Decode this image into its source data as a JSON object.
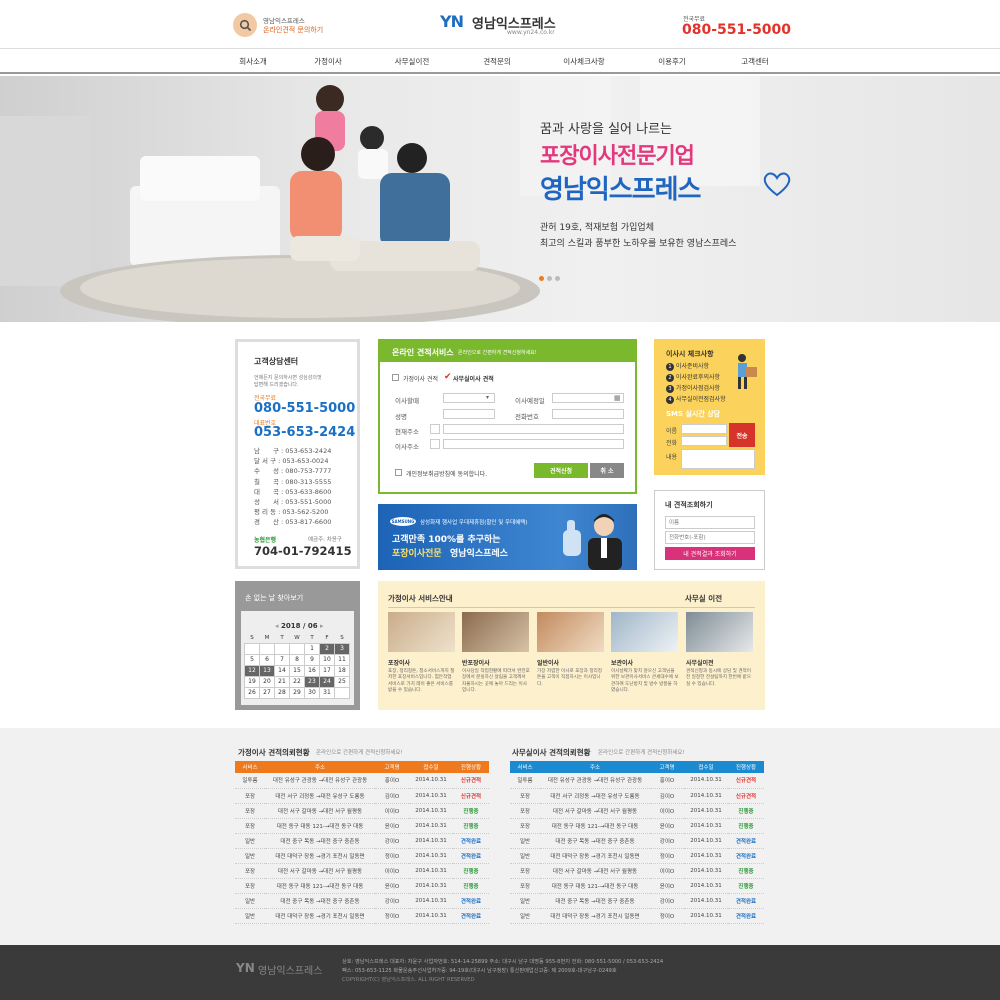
{
  "header": {
    "consult_line1": "영남익스프레스",
    "consult_line2": "온라인견적 문의하기",
    "logo_yn": "YN",
    "logo_name": "영남익스프레스",
    "logo_url": "www.yn24.co.kr",
    "phone_label": "전국무료",
    "phone": "080-551-5000"
  },
  "nav": [
    "회사소개",
    "가정이사",
    "사무실이전",
    "견적문의",
    "이사체크사항",
    "이용후기",
    "고객센터"
  ],
  "hero": {
    "line1": "꿈과 사랑을 실어 나르는",
    "line2": "포장이사전문기업",
    "line3": "영남익스프레스",
    "line4": "관허 19호, 적재보험 가입업체",
    "line5": "최고의 스킬과 풍부한 노하우를 보유한 영남스프레스"
  },
  "customer_center": {
    "title": "고객상담센터",
    "desc1": "언제든지 문의하시면 성심성의껏",
    "desc2": "답변해 드리겠습니다.",
    "label_free": "전국무료",
    "phone_free": "080-551-5000",
    "label_rep": "대표번호",
    "phone_rep": "053-653-2424",
    "branches": [
      {
        "name": "남　　구",
        "tel": "053-653-2424"
      },
      {
        "name": "달 서 구",
        "tel": "053-653-0024"
      },
      {
        "name": "수　　성",
        "tel": "080-753-7777"
      },
      {
        "name": "칠　　곡",
        "tel": "080-313-5555"
      },
      {
        "name": "대　　곡",
        "tel": "053-633-8600"
      },
      {
        "name": "성　　서",
        "tel": "053-551-5000"
      },
      {
        "name": "평 리 동",
        "tel": "053-562-5200"
      },
      {
        "name": "경　　산",
        "tel": "053-817-6600"
      }
    ],
    "bank": "농협은행",
    "holder": "예금주: 차윤구",
    "account": "704-01-792415"
  },
  "estimate": {
    "title": "온라인 견적서비스",
    "subtitle": "온라인으로 간편하게 견적신청하세요!",
    "radio1": "가정이사 견적",
    "radio2": "사무실이사 견적",
    "f_date": "이사할때",
    "f_moveday": "이사예정일",
    "f_name": "성명",
    "f_tel": "전화번호",
    "f_cur": "현재주소",
    "f_new": "이사주소",
    "agree": "개인정보취급방침에 동의합니다.",
    "submit": "견적신청",
    "cancel": "취 소"
  },
  "checklist": {
    "title": "이사시 체크사항",
    "items": [
      "이사준비사항",
      "이사완료후의사항",
      "가정이사점검사항",
      "사무실이전점검사항"
    ],
    "sms_title": "SMS 실시간 상담",
    "f_name": "이름",
    "f_tel": "전화",
    "f_content": "내용",
    "send": "전송"
  },
  "banner": {
    "brand": "SAMSUNG",
    "line1": "삼성화재 행사업 우대제휴점(할인 및 우대혜택)",
    "line2": "고객만족 100%를 추구하는",
    "line3": "포장이사전문",
    "line4": "영남익스프레스"
  },
  "lookup": {
    "title": "내 견적조회하기",
    "name_ph": "이름",
    "tel_ph": "전화번호(-포함)",
    "button": "내 견적결과 조회하기"
  },
  "calendar": {
    "title": "손 없는 날 찾아보기",
    "month": "2018 / 06",
    "days": [
      "S",
      "M",
      "T",
      "W",
      "T",
      "F",
      "S"
    ],
    "weeks": [
      [
        "",
        "",
        "",
        "",
        "1",
        "2",
        "3"
      ],
      [
        "",
        "",
        "",
        "",
        "",
        "",
        ""
      ],
      [
        "5",
        "6",
        "7",
        "8",
        "9",
        "10",
        "11"
      ],
      [
        "12",
        "13",
        "14",
        "15",
        "16",
        "17",
        "18"
      ],
      [
        "19",
        "20",
        "21",
        "22",
        "23",
        "24",
        "25"
      ],
      [
        "26",
        "27",
        "28",
        "29",
        "30",
        "31",
        ""
      ]
    ]
  },
  "services": {
    "title_home": "가정이사 서비스안내",
    "title_office": "사무실 이전",
    "items": [
      {
        "name": "포장이사",
        "desc": "포장, 정리정돈, 청소서비스까지 철저한 포장서비스입니다. 힘든작업 서비스로 가치 레이 좋은 서비스를 받을 수 있습니다."
      },
      {
        "name": "반포장이사",
        "desc": "이사당일 작업현황에 따라서 완전포장에서 분실하신 살림을 고객께서 자율하시는 곳에 놓아 드리는 이사입니다."
      },
      {
        "name": "일반이사",
        "desc": "가장 저렴한 이사로 포장과 정리정돈을 고객이 직접하시는 이사입니다."
      },
      {
        "name": "보관이사",
        "desc": "이사날짜가 맞지 않으신 고객님을 위한 보관이사서비스 큰세대수에 보관하여 도난방지 및 방수 방풍을 하였습니다."
      },
      {
        "name": "사무실이전",
        "desc": "견적신청과 동시에 상담 및 견적이전 일정한 전설팀까지 한번에 받으실 수 있습니다."
      }
    ]
  },
  "home_table": {
    "title": "가정이사 견적의뢰현황",
    "subtitle": "온라인으로 간편하게 견적신청하세요!",
    "headers": [
      "서비스",
      "주소",
      "고객명",
      "접수일",
      "진행상황"
    ],
    "rows": [
      [
        "일투룸",
        "대전 유성구 관광동 →대전 유성구 관광동",
        "홍이O",
        "2014.10.31",
        "신규견적"
      ],
      [
        "포장",
        "대전 서구 괴정동 →대전 유성구 도룡동",
        "김이O",
        "2014.10.31",
        "신규견적"
      ],
      [
        "포장",
        "대전 서구 갈마동 →대전 서구 월평동",
        "이이O",
        "2014.10.31",
        "진행중"
      ],
      [
        "포장",
        "대전 동구 대동 121-→대전 동구 대동",
        "윤이O",
        "2014.10.31",
        "진행중"
      ],
      [
        "일반",
        "대전 중구 목동 →대전 중구 중촌동",
        "강이O",
        "2014.10.31",
        "견적완료"
      ],
      [
        "일반",
        "대전 대덕구 장동 →경기 포천시 일동면",
        "정이O",
        "2014.10.31",
        "견적완료"
      ],
      [
        "포장",
        "대전 서구 갈마동 →대전 서구 월평동",
        "이이O",
        "2014.10.31",
        "진행중"
      ],
      [
        "포장",
        "대전 동구 대동 121-→대전 동구 대동",
        "윤이O",
        "2014.10.31",
        "진행중"
      ],
      [
        "일반",
        "대전 중구 목동 →대전 중구 중촌동",
        "강이O",
        "2014.10.31",
        "견적완료"
      ],
      [
        "일반",
        "대전 대덕구 장동 →경기 포천시 일동면",
        "정이O",
        "2014.10.31",
        "견적완료"
      ]
    ]
  },
  "office_table": {
    "title": "사무실이사 견적의뢰현황",
    "subtitle": "온라인으로 간편하게 견적신청하세요!",
    "headers": [
      "서비스",
      "주소",
      "고객명",
      "접수일",
      "진행상황"
    ],
    "rows": [
      [
        "일투룸",
        "대전 유성구 관광동 →대전 유성구 관광동",
        "홍이O",
        "2014.10.31",
        "신규견적"
      ],
      [
        "포장",
        "대전 서구 괴정동 →대전 유성구 도룡동",
        "김이O",
        "2014.10.31",
        "신규견적"
      ],
      [
        "포장",
        "대전 서구 갈마동 →대전 서구 월평동",
        "이이O",
        "2014.10.31",
        "진행중"
      ],
      [
        "포장",
        "대전 동구 대동 121-→대전 동구 대동",
        "윤이O",
        "2014.10.31",
        "진행중"
      ],
      [
        "일반",
        "대전 중구 목동 →대전 중구 중촌동",
        "강이O",
        "2014.10.31",
        "견적완료"
      ],
      [
        "일반",
        "대전 대덕구 장동 →경기 포천시 일동면",
        "정이O",
        "2014.10.31",
        "견적완료"
      ],
      [
        "포장",
        "대전 서구 갈마동 →대전 서구 월평동",
        "이이O",
        "2014.10.31",
        "진행중"
      ],
      [
        "포장",
        "대전 동구 대동 121-→대전 동구 대동",
        "윤이O",
        "2014.10.31",
        "진행중"
      ],
      [
        "일반",
        "대전 중구 목동 →대전 중구 중촌동",
        "강이O",
        "2014.10.31",
        "견적완료"
      ],
      [
        "일반",
        "대전 대덕구 장동 →경기 포천시 일동면",
        "정이O",
        "2014.10.31",
        "견적완료"
      ]
    ]
  },
  "footer": {
    "logo_yn": "YN",
    "logo_name": "영남익스프레스",
    "line1": "상호: 영남익스프레스  대표자: 차윤구  사업자번호: 514-14-25899  주소: 대구시 남구 대명동 955-8번지  전화: 080-551-5000 / 053-653-2424",
    "line2": "팩스: 053-653-1125  화물운송주선사업허가증: 94-19호(대구시 남구청장)  통신판매업신고증: 제 2009호-대구남구-0249호",
    "line3": "COPYRIGHT(C) 영남익스프레스. ALL RIGHT RESERVED"
  },
  "colors": {
    "green": "#7ab82e",
    "orange": "#ee7a1d",
    "blue": "#1b6fc4",
    "pink": "#d9317a",
    "red": "#d6342b",
    "yellow": "#fbd35c"
  }
}
